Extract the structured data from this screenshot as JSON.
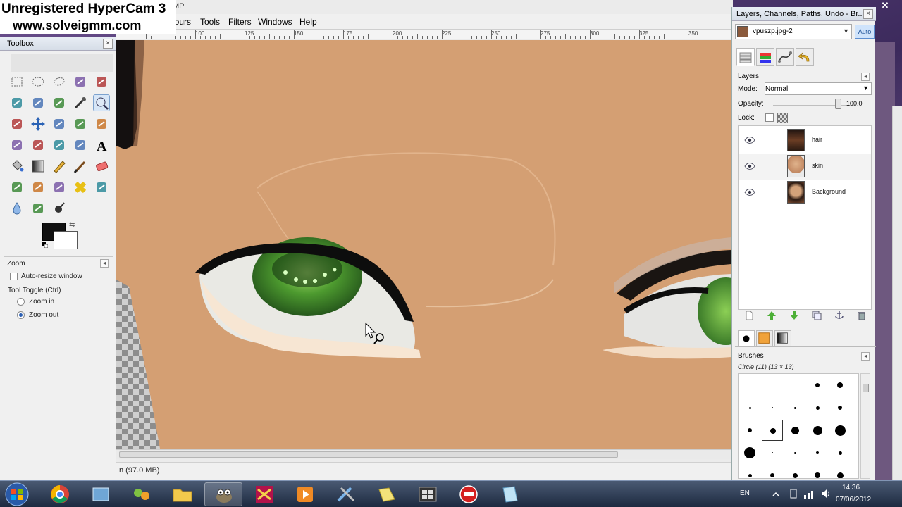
{
  "watermark": {
    "line1": "Unregistered HyperCam 3",
    "line2": "www.solveigmm.com"
  },
  "image_window": {
    "title_fragment": "MP",
    "menu": [
      "lours",
      "Tools",
      "Filters",
      "Windows",
      "Help"
    ],
    "ruler_labels": [
      "100",
      "125",
      "150",
      "175",
      "200",
      "225",
      "250",
      "275",
      "300",
      "325",
      "350"
    ],
    "status": "n (97.0 MB)"
  },
  "toolbox": {
    "title": "Toolbox",
    "close": "×",
    "tools": [
      "rect-select",
      "ellipse-select",
      "free-select",
      "fuzzy-select",
      "color-select",
      "scissors",
      "foreground-select",
      "paths",
      "color-picker",
      "zoom",
      "measure",
      "move",
      "align",
      "crop",
      "rotate",
      "scale",
      "shear",
      "perspective",
      "flip",
      "text",
      "bucket-fill",
      "blend",
      "pencil",
      "paintbrush",
      "eraser",
      "airbrush",
      "ink",
      "clone",
      "heal",
      "perspective-clone",
      "blur",
      "smudge",
      "dodge-burn"
    ],
    "options": {
      "title": "Zoom",
      "auto_resize": "Auto-resize window",
      "tool_toggle": "Tool Toggle  (Ctrl)",
      "zoom_in": "Zoom in",
      "zoom_out": "Zoom out"
    },
    "foreground_color": "#111111",
    "background_color": "#ffffff"
  },
  "dock": {
    "title": "Layers, Channels, Paths, Undo - Br...",
    "image_name": "vpuszp.jpg-2",
    "auto_label": "Auto",
    "layers_title": "Layers",
    "mode_label": "Mode:",
    "mode_value": "Normal",
    "opacity_label": "Opacity:",
    "opacity_value": "100.0",
    "lock_label": "Lock:",
    "layers": [
      {
        "name": "hair"
      },
      {
        "name": "skin"
      },
      {
        "name": "Background"
      }
    ],
    "brushes_title": "Brushes",
    "brush_name": "Circle (11) (13 × 13)"
  },
  "taskbar": {
    "language": "EN",
    "time": "14:36",
    "date": "07/06/2012"
  },
  "colors": {
    "skin": "#d49f73",
    "iris": "#3f8a2a",
    "accent": "#2b5fb3"
  }
}
